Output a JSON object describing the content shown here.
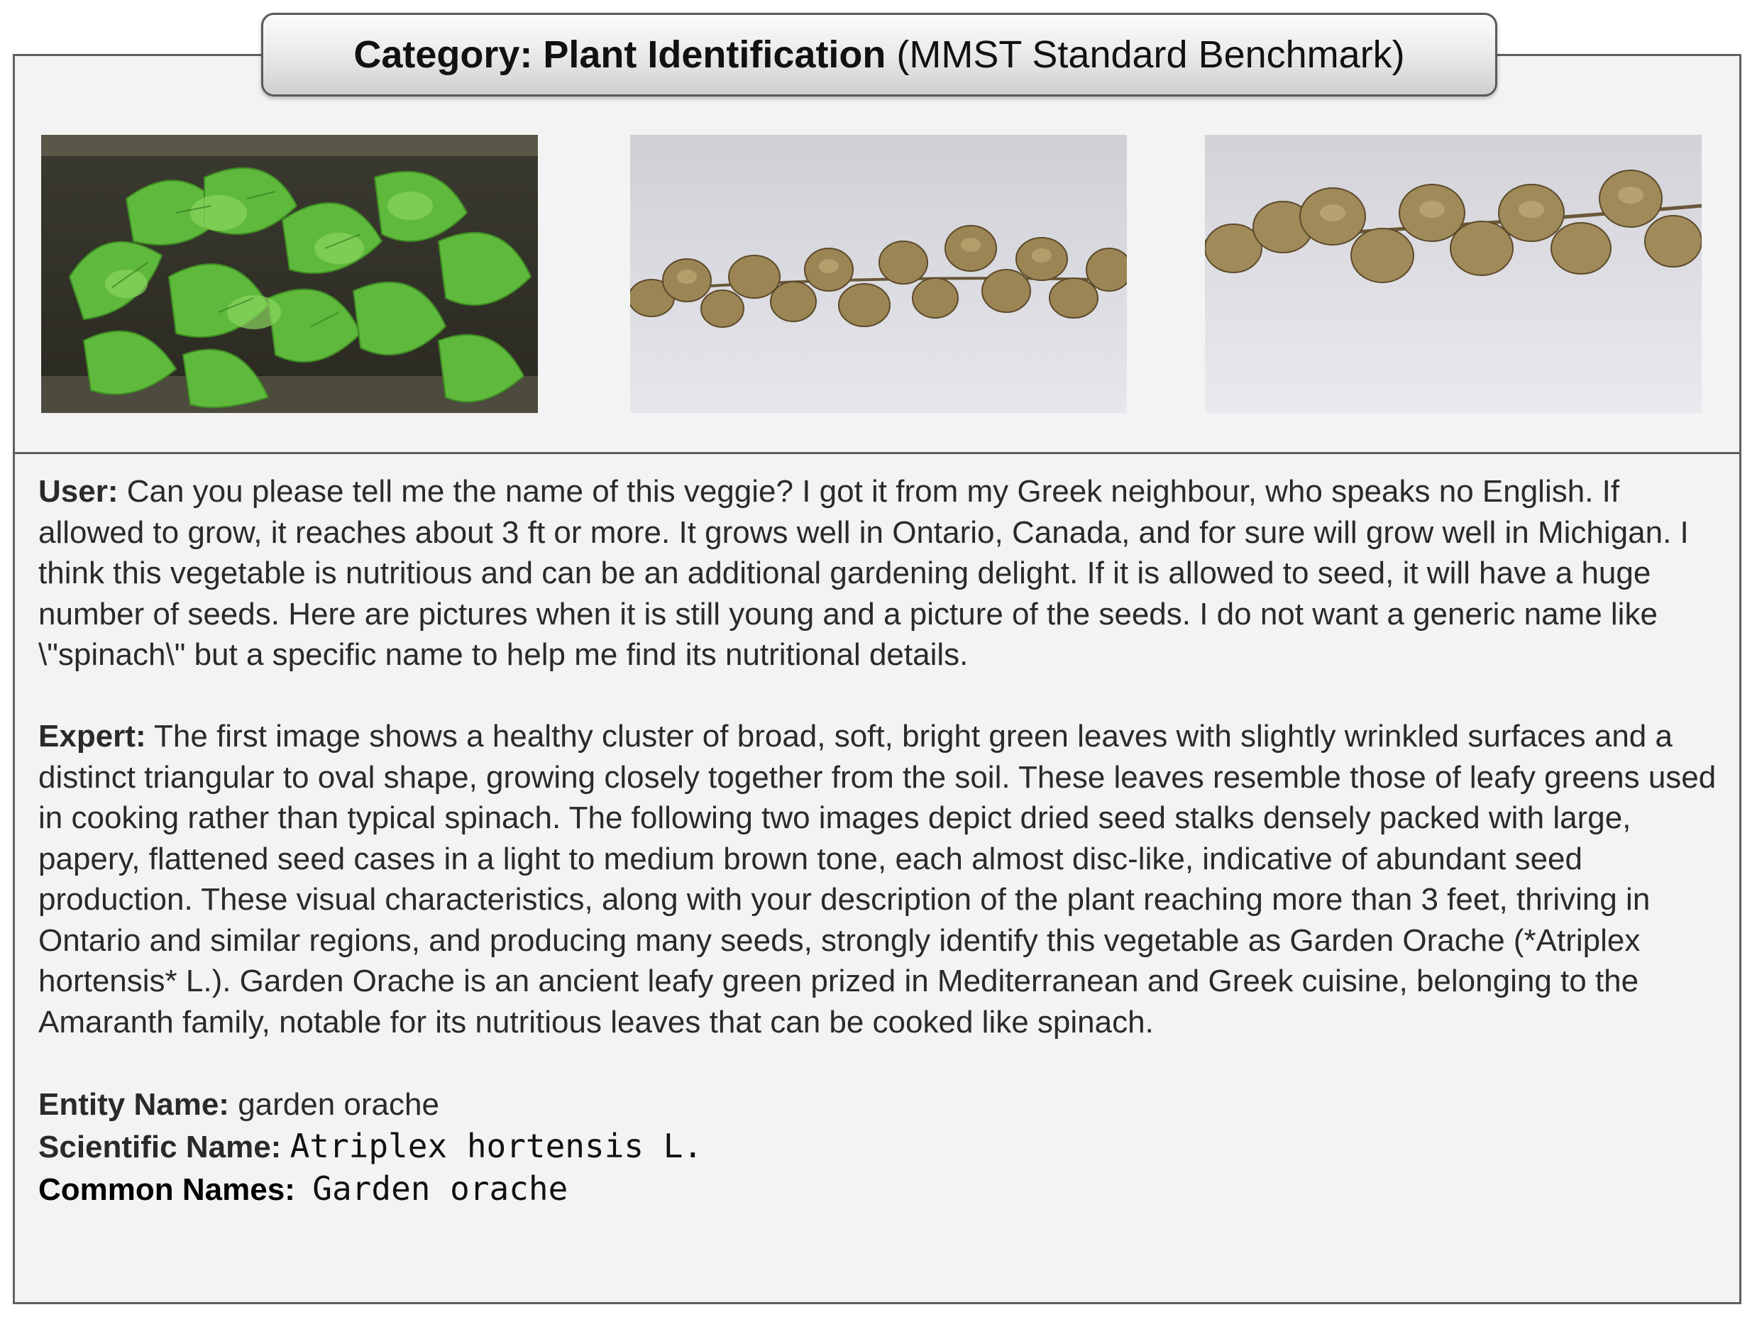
{
  "header": {
    "category_label": "Category: Plant Identification",
    "benchmark": "(MMST Standard Benchmark)"
  },
  "images": [
    {
      "name": "young-plant-leaves"
    },
    {
      "name": "dried-seed-stalk-1"
    },
    {
      "name": "dried-seed-stalk-2"
    }
  ],
  "conversation": {
    "user_label": "User:",
    "user_text": "Can you please tell me the name of this veggie? I got it from my Greek neighbour, who speaks no English. If allowed to grow, it reaches about 3 ft or more. It grows well in Ontario, Canada, and for sure will grow well in Michigan. I think this vegetable is nutritious and can be an additional gardening delight. If it is allowed to seed, it will have a huge number of seeds. Here are pictures when it is still young and a picture of the seeds. I do not want a generic name like \\\"spinach\\\" but a specific name to help me find its nutritional details.",
    "expert_label": "Expert:",
    "expert_text": "The first image shows a healthy cluster of broad, soft, bright green leaves with slightly wrinkled surfaces and a distinct triangular to oval shape, growing closely together from the soil. These leaves resemble those of leafy greens used in cooking rather than typical spinach. The following two images depict dried seed stalks densely packed with large, papery, flattened seed cases in a light to medium brown tone, each almost disc-like, indicative of abundant seed production. These visual characteristics, along with your description of the plant reaching more than 3 feet, thriving in Ontario and similar regions, and producing many seeds, strongly identify this vegetable as Garden Orache (*Atriplex hortensis* L.). Garden Orache is an ancient leafy green prized in Mediterranean and Greek cuisine, belonging to the Amaranth family, notable for its nutritious leaves that can be cooked like spinach."
  },
  "entity": {
    "entity_label": "Entity Name:",
    "entity_value": "garden orache",
    "scientific_label": "Scientific Name:",
    "scientific_value": "Atriplex hortensis L.",
    "common_label": "Common Names:",
    "common_value": "Garden orache"
  },
  "colors": {
    "card_bg": "#f3f3f3",
    "border": "#5f5f5f",
    "leaf_green": "#6cc24a",
    "seed_brown": "#8a7246"
  }
}
